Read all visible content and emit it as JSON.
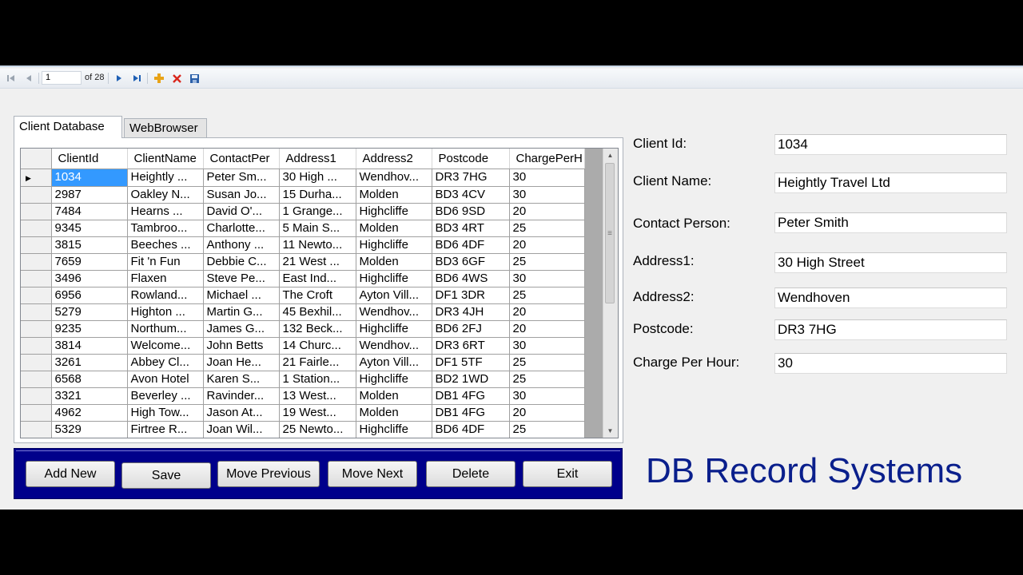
{
  "navigator": {
    "position": "1",
    "count_label": "of 28"
  },
  "tabs": [
    {
      "label": "Client Database",
      "active": true
    },
    {
      "label": "WebBrowser",
      "active": false
    }
  ],
  "grid": {
    "columns": [
      "ClientId",
      "ClientName",
      "ContactPer",
      "Address1",
      "Address2",
      "Postcode",
      "ChargePerH"
    ],
    "rows": [
      [
        "1034",
        "Heightly ...",
        "Peter Sm...",
        "30 High ...",
        "Wendhov...",
        "DR3 7HG",
        "30"
      ],
      [
        "2987",
        "Oakley N...",
        "Susan Jo...",
        "15 Durha...",
        "Molden",
        "BD3 4CV",
        "30"
      ],
      [
        "7484",
        "Hearns ...",
        "David O'...",
        "1 Grange...",
        "Highcliffe",
        "BD6 9SD",
        "20"
      ],
      [
        "9345",
        "Tambroo...",
        "Charlotte...",
        "5 Main S...",
        "Molden",
        "BD3 4RT",
        "25"
      ],
      [
        "3815",
        "Beeches ...",
        "Anthony ...",
        "11 Newto...",
        "Highcliffe",
        "BD6 4DF",
        "20"
      ],
      [
        "7659",
        "Fit 'n Fun",
        "Debbie C...",
        "21 West ...",
        "Molden",
        "BD3 6GF",
        "25"
      ],
      [
        "3496",
        "Flaxen",
        "Steve Pe...",
        "East Ind...",
        "Highcliffe",
        "BD6 4WS",
        "30"
      ],
      [
        "6956",
        "Rowland...",
        "Michael ...",
        "The Croft",
        "Ayton Vill...",
        "DF1 3DR",
        "25"
      ],
      [
        "5279",
        "Highton ...",
        "Martin G...",
        "45 Bexhil...",
        "Wendhov...",
        "DR3 4JH",
        "20"
      ],
      [
        "9235",
        "Northum...",
        "James G...",
        "132 Beck...",
        "Highcliffe",
        "BD6 2FJ",
        "20"
      ],
      [
        "3814",
        "Welcome...",
        "John Betts",
        "14 Churc...",
        "Wendhov...",
        "DR3 6RT",
        "30"
      ],
      [
        "3261",
        "Abbey Cl...",
        "Joan He...",
        "21 Fairle...",
        "Ayton Vill...",
        "DF1 5TF",
        "25"
      ],
      [
        "6568",
        "Avon Hotel",
        "Karen S...",
        "1 Station...",
        "Highcliffe",
        "BD2 1WD",
        "25"
      ],
      [
        "3321",
        "Beverley ...",
        "Ravinder...",
        "13 West...",
        "Molden",
        "DB1 4FG",
        "30"
      ],
      [
        "4962",
        "High Tow...",
        "Jason At...",
        "19 West...",
        "Molden",
        "DB1 4FG",
        "20"
      ],
      [
        "5329",
        "Firtree R...",
        "Joan Wil...",
        "25 Newto...",
        "Highcliffe",
        "BD6 4DF",
        "25"
      ]
    ],
    "selected_row": 0
  },
  "buttons": {
    "add_new": "Add New",
    "save": "Save",
    "move_previous": "Move Previous",
    "move_next": "Move Next",
    "delete": "Delete",
    "exit": "Exit"
  },
  "form": {
    "client_id_label": "Client Id:",
    "client_id_value": "1034",
    "client_name_label": "Client Name:",
    "client_name_value": "Heightly Travel Ltd",
    "contact_person_label": "Contact Person:",
    "contact_person_value": "Peter Smith",
    "address1_label": "Address1:",
    "address1_value": "30 High Street",
    "address2_label": "Address2:",
    "address2_value": "Wendhoven",
    "postcode_label": "Postcode:",
    "postcode_value": "DR3 7HG",
    "charge_label": "Charge Per Hour:",
    "charge_value": "30"
  },
  "brand": "DB Record Systems",
  "colors": {
    "button_bar": "#00008b",
    "brand_text": "#0a1f8c",
    "selection": "#3399ff"
  }
}
